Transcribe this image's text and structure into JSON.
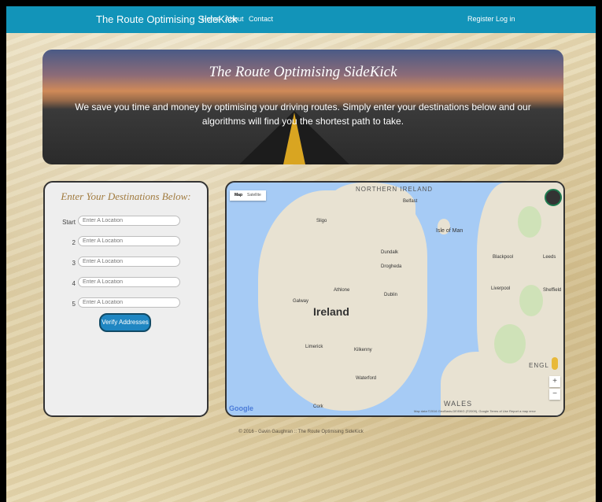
{
  "navbar": {
    "brand": "The Route Optimising SideKick",
    "links": [
      "Home",
      "About",
      "Contact"
    ],
    "register": "Register",
    "login": "Log in"
  },
  "hero": {
    "title": "The Route Optimising SideKick",
    "text": "We save you time and money by optimising your driving routes. Simply enter your destinations below and our algorithms will find you the shortest path to take."
  },
  "form": {
    "title": "Enter Your Destinations Below:",
    "rows": [
      {
        "label": "Start",
        "placeholder": "Enter A Location"
      },
      {
        "label": "2",
        "placeholder": "Enter A Location"
      },
      {
        "label": "3",
        "placeholder": "Enter A Location"
      },
      {
        "label": "4",
        "placeholder": "Enter A Location"
      },
      {
        "label": "5",
        "placeholder": "Enter A Location"
      }
    ],
    "verify_label": "Verify Addresses"
  },
  "map": {
    "tab_map": "Map",
    "tab_satellite": "Satellite",
    "labels": {
      "northern_ireland": "NORTHERN IRELAND",
      "belfast": "Belfast",
      "isle_of_man": "Isle of Man",
      "ireland": "Ireland",
      "dublin": "Dublin",
      "galway": "Galway",
      "limerick": "Limerick",
      "cork": "Cork",
      "waterford": "Waterford",
      "wales": "WALES",
      "liverpool": "Liverpool",
      "leeds": "Leeds",
      "sheffield": "Sheffield",
      "blackpool": "Blackpool",
      "engl": "ENGL",
      "sligo": "Sligo",
      "athlone": "Athlone",
      "kilkenny": "Kilkenny",
      "drogheda": "Drogheda",
      "dundalk": "Dundalk"
    },
    "google": "Google",
    "attribution": "Map data ©2016 GeoBasis-DE/BKG (©2009), Google   Terms of Use   Report a map error",
    "zoom_in": "+",
    "zoom_out": "−"
  },
  "footer": {
    "text": "© 2016 - Gavin Gaughran :: The Route Optimising SideKick"
  },
  "colors": {
    "navbar": "#1294b9",
    "button": "#1f86c2",
    "form_title": "#a07a3e",
    "water": "#a6cbf5"
  },
  "icons": [
    "pegman-icon",
    "zoom-in-icon",
    "zoom-out-icon"
  ]
}
